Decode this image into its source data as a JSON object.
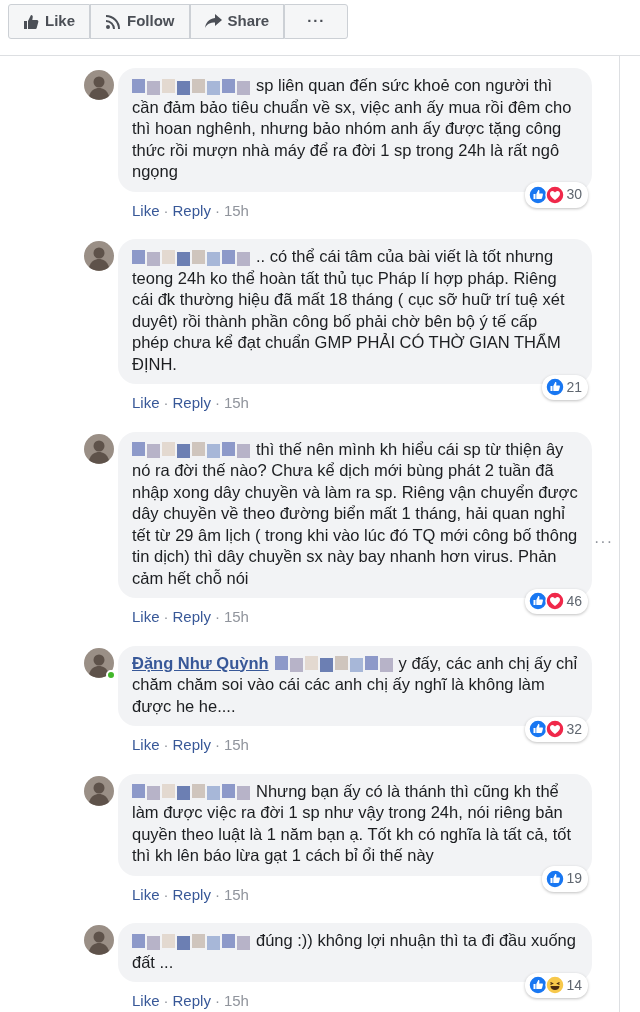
{
  "toolbar": [
    {
      "kind": "like",
      "label": "Like"
    },
    {
      "kind": "follow",
      "label": "Follow"
    },
    {
      "kind": "share",
      "label": "Share"
    },
    {
      "kind": "more",
      "label": "···"
    }
  ],
  "comments": [
    {
      "name_censored": true,
      "online": false,
      "text": "sp liên quan đến sức khoẻ con người thì cần đảm bảo tiêu chuẩn về sx, việc anh ấy mua rồi đêm cho thì hoan nghênh, nhưng bảo nhóm anh ấy được tặng công thức rồi mượn nhà máy để ra đời 1 sp trong 24h là rất ngô ngọng",
      "reactions": [
        {
          "kind": "like"
        },
        {
          "kind": "love"
        }
      ],
      "count": "30",
      "actions": [
        {
          "kind": "like",
          "text": "Like"
        },
        {
          "kind": "sep",
          "text": "·"
        },
        {
          "kind": "reply",
          "text": "Reply"
        },
        {
          "kind": "sep",
          "text": "·"
        },
        {
          "kind": "time",
          "text": "15h"
        }
      ]
    },
    {
      "name_censored": true,
      "online": false,
      "text": ".. có thể cái tâm của bài viết là tốt nhưng teong 24h ko thể hoàn tất thủ tục Pháp lí hợp pháp. Riêng cái đk thường hiệu đã mất 18 tháng ( cục sỡ huữ trí tuệ xét duyêt) rồi thành phần công bố phải chờ bên bộ ý tế cấp phép chưa kể đạt chuẩn GMP PHẢI CÓ THỜ GIAN THẨM ĐỊNH.",
      "reactions": [
        {
          "kind": "like"
        }
      ],
      "count": "21",
      "actions": [
        {
          "kind": "like",
          "text": "Like"
        },
        {
          "kind": "sep",
          "text": "·"
        },
        {
          "kind": "reply",
          "text": "Reply"
        },
        {
          "kind": "sep",
          "text": "·"
        },
        {
          "kind": "time",
          "text": "15h"
        }
      ]
    },
    {
      "name_censored": true,
      "online": false,
      "text": "thì thế nên mình kh hiểu cái sp từ thiện ây nó ra đời thế nào? Chưa kể dịch mới bùng phát 2 tuần đã nhập xong dây chuyền và làm ra sp. Riêng vận chuyển được dây chuyền về theo đường biển mất 1 tháng, hải quan nghỉ tết từ 29 âm lịch ( trong khi vào lúc đó TQ mới công bố thông tin dịch) thì dây chuyền sx này bay nhanh hơn virus. Phản cảm hết chỗ nói",
      "reactions": [
        {
          "kind": "like"
        },
        {
          "kind": "love"
        }
      ],
      "count": "46",
      "actions": [
        {
          "kind": "like",
          "text": "Like"
        },
        {
          "kind": "sep",
          "text": "·"
        },
        {
          "kind": "reply",
          "text": "Reply"
        },
        {
          "kind": "sep",
          "text": "·"
        },
        {
          "kind": "time",
          "text": "15h"
        }
      ],
      "menu_label": "···"
    },
    {
      "author": "Đặng Như Quỳnh",
      "name_censored": true,
      "online": true,
      "text": "y đấy, các anh chị ấy chỉ chăm chăm soi vào cái các anh chị ấy nghĩ là không làm được he he....",
      "reactions": [
        {
          "kind": "like"
        },
        {
          "kind": "love"
        }
      ],
      "count": "32",
      "actions": [
        {
          "kind": "like",
          "text": "Like"
        },
        {
          "kind": "sep",
          "text": "·"
        },
        {
          "kind": "reply",
          "text": "Reply"
        },
        {
          "kind": "sep",
          "text": "·"
        },
        {
          "kind": "time",
          "text": "15h"
        }
      ]
    },
    {
      "name_censored": true,
      "online": false,
      "text": "Nhưng bạn ấy có là thánh thì cũng kh thể làm được việc ra đời 1 sp như vậy trong 24h, nói riêng bản quyền theo luật là 1 năm bạn ạ. Tốt kh có nghĩa là tất cả, tốt thì kh lên báo lừa gạt 1 cách bỉ ổi thế này",
      "reactions": [
        {
          "kind": "like"
        }
      ],
      "count": "19",
      "actions": [
        {
          "kind": "like",
          "text": "Like"
        },
        {
          "kind": "sep",
          "text": "·"
        },
        {
          "kind": "reply",
          "text": "Reply"
        },
        {
          "kind": "sep",
          "text": "·"
        },
        {
          "kind": "time",
          "text": "15h"
        }
      ]
    },
    {
      "name_censored": true,
      "online": false,
      "text": "đúng :)) không lợi nhuận thì ta đi đầu xuống đất ...",
      "reactions": [
        {
          "kind": "like"
        },
        {
          "kind": "haha"
        }
      ],
      "count": "14",
      "actions": [
        {
          "kind": "like",
          "text": "Like"
        },
        {
          "kind": "sep",
          "text": "·"
        },
        {
          "kind": "reply",
          "text": "Reply"
        },
        {
          "kind": "sep",
          "text": "·"
        },
        {
          "kind": "time",
          "text": "15h"
        }
      ]
    }
  ]
}
